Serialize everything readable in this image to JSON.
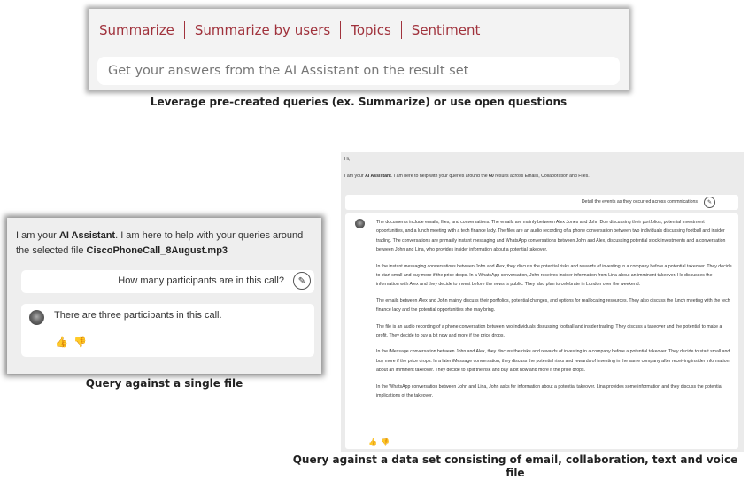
{
  "top_panel": {
    "tabs": [
      {
        "label": "Summarize"
      },
      {
        "label": "Summarize by users"
      },
      {
        "label": "Topics"
      },
      {
        "label": "Sentiment"
      }
    ],
    "input_placeholder": "Get your answers from the AI Assistant on the result set",
    "caption": "Leverage pre-created queries (ex. Summarize) or use open questions"
  },
  "single_file": {
    "intro_pre": "I am your ",
    "assistant_name": "AI Assistant",
    "intro_mid": ". I am here to help with your queries around the selected file ",
    "file_name": "CiscoPhoneCall_8August.mp3",
    "question": "How many participants are in this call?",
    "answer": "There are three participants in this call.",
    "caption": "Query against a single file"
  },
  "data_set": {
    "greeting": "Hi,",
    "intro_pre": "I am your ",
    "assistant_name": "AI Assistant",
    "intro_mid": ". I am here to help with your queries around the ",
    "result_count": "60",
    "intro_post": " results across Emails, Collaboration and Files.",
    "question": "Detail the events as they occurred across commnications",
    "answer_paragraphs": [
      "The documents include emails, files, and conversations. The emails are mainly between Alex Jones and John Doe discussing their portfolios, potential investment opportunities, and a lunch meeting with a tech finance lady. The files are an audio recording of a phone conversation between two individuals discussing football and insider trading. The conversations are primarily instant messaging and WhatsApp conversations between John and Alex, discussing potential stock investments and a conversation between John and Lina, who provides insider information about a potential takeover.",
      "In the instant messaging conversations between John and Alex, they discuss the potential risks and rewards of investing in a company before a potential takeover. They decide to start small and buy more if the price drops. In a WhatsApp conversation, John receives insider information from Lina about an imminent takeover. He discusses the information with Alex and they decide to invest before the news is public. They also plan to celebrate in London over the weekend.",
      "The emails between Alex and John mainly discuss their portfolios, potential changes, and options for reallocating resources. They also discuss the lunch meeting with the tech finance lady and the potential opportunities she may bring.",
      "The file is an audio recording of a phone conversation between two individuals discussing football and insider trading. They discuss a takeover and the potential to make a profit. They decide to buy a bit now and more if the price drops.",
      "In the iMessage conversation between John and Alex, they discuss the risks and rewards of investing in a company before a potential takeover. They decide to start small and buy more if the price drops. In a later iMessage conversation, they discuss the potential risks and rewards of investing in the same company after receiving insider information about an imminent takeover. They decide to split the risk and buy a bit now and more if the price drops.",
      "In the WhatsApp conversation between John and Lina, John asks for information about a potential takeover. Lina provides some information and they discuss the potential implications of the takeover."
    ],
    "caption_line1": "Query against a data set consisting of email, collaboration, text and voice",
    "caption_line2": "file"
  },
  "colors": {
    "tab_accent": "#a0323c",
    "panel_bg": "#eeeeee"
  },
  "icons": {
    "thumbs_up": "thumbs-up-icon",
    "thumbs_down": "thumbs-down-icon",
    "user_avatar": "user-avatar-icon",
    "assistant_avatar": "assistant-avatar-icon"
  }
}
